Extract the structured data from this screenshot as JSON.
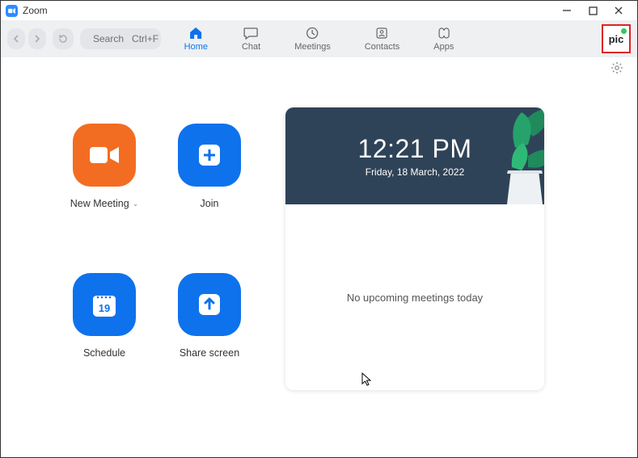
{
  "window": {
    "title": "Zoom"
  },
  "toolbar": {
    "search_label": "Search",
    "shortcut": "Ctrl+F"
  },
  "tabs": {
    "home": "Home",
    "chat": "Chat",
    "meetings": "Meetings",
    "contacts": "Contacts",
    "apps": "Apps"
  },
  "avatar": {
    "text": "pic"
  },
  "actions": {
    "new_meeting": "New Meeting",
    "join": "Join",
    "schedule": "Schedule",
    "schedule_day": "19",
    "share": "Share screen"
  },
  "card": {
    "time": "12:21 PM",
    "date": "Friday, 18 March, 2022",
    "empty": "No upcoming meetings today"
  }
}
